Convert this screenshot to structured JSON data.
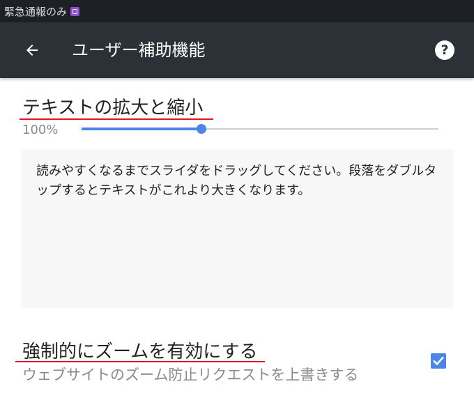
{
  "status_bar": {
    "text": "緊急通報のみ",
    "badge_icon": "image-badge-icon"
  },
  "app_bar": {
    "back_icon": "arrow-back-icon",
    "title": "ユーザー補助機能",
    "help_label": "?",
    "help_icon": "help-circle-icon"
  },
  "text_scaling": {
    "title": "テキストの拡大と縮小",
    "value_label": "100%",
    "slider_fraction": 0.335,
    "preview_text": "読みやすくなるまでスライダをドラッグしてください。段落をダブルタップするとテキストがこれより大きくなります。"
  },
  "force_zoom": {
    "title": "強制的にズームを有効にする",
    "summary": "ウェブサイトのズーム防止リクエストを上書きする",
    "checked": true
  },
  "colors": {
    "status_bar_bg": "#1d2126",
    "app_bar_bg": "#2b3137",
    "accent": "#4a86e8",
    "annotation_underline": "#e0141c",
    "preview_bg": "#f7f7f7"
  }
}
